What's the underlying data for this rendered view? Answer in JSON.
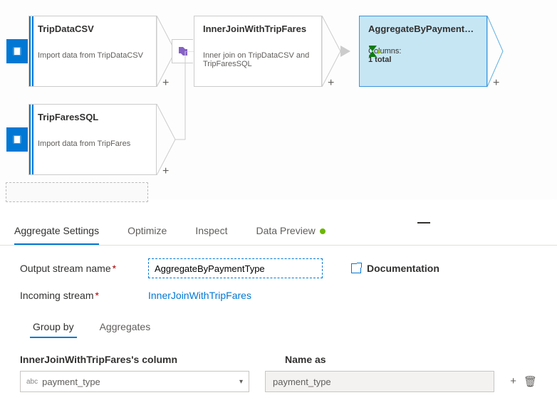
{
  "nodes": {
    "tripdata": {
      "title": "TripDataCSV",
      "sub": "Import data from TripDataCSV"
    },
    "tripfares": {
      "title": "TripFaresSQL",
      "sub": "Import data from TripFares"
    },
    "join": {
      "title": "InnerJoinWithTripFares",
      "sub": "Inner join on TripDataCSV and TripFaresSQL"
    },
    "agg": {
      "title": "AggregateByPaymentTy...",
      "sub_label": "Columns:",
      "sub_value": "1 total"
    }
  },
  "tabs": {
    "settings": "Aggregate Settings",
    "optimize": "Optimize",
    "inspect": "Inspect",
    "preview": "Data Preview"
  },
  "form": {
    "output_label": "Output stream name",
    "output_value": "AggregateByPaymentType",
    "incoming_label": "Incoming stream",
    "incoming_value": "InnerJoinWithTripFares",
    "doc": "Documentation"
  },
  "subtabs": {
    "groupby": "Group by",
    "aggs": "Aggregates"
  },
  "columns": {
    "left_header": "InnerJoinWithTripFares's column",
    "right_header": "Name as",
    "abc_prefix": "abc",
    "value": "payment_type",
    "alias": "payment_type"
  },
  "glyphs": {
    "plus": "+",
    "caret": "▾",
    "trash": "🗑"
  }
}
